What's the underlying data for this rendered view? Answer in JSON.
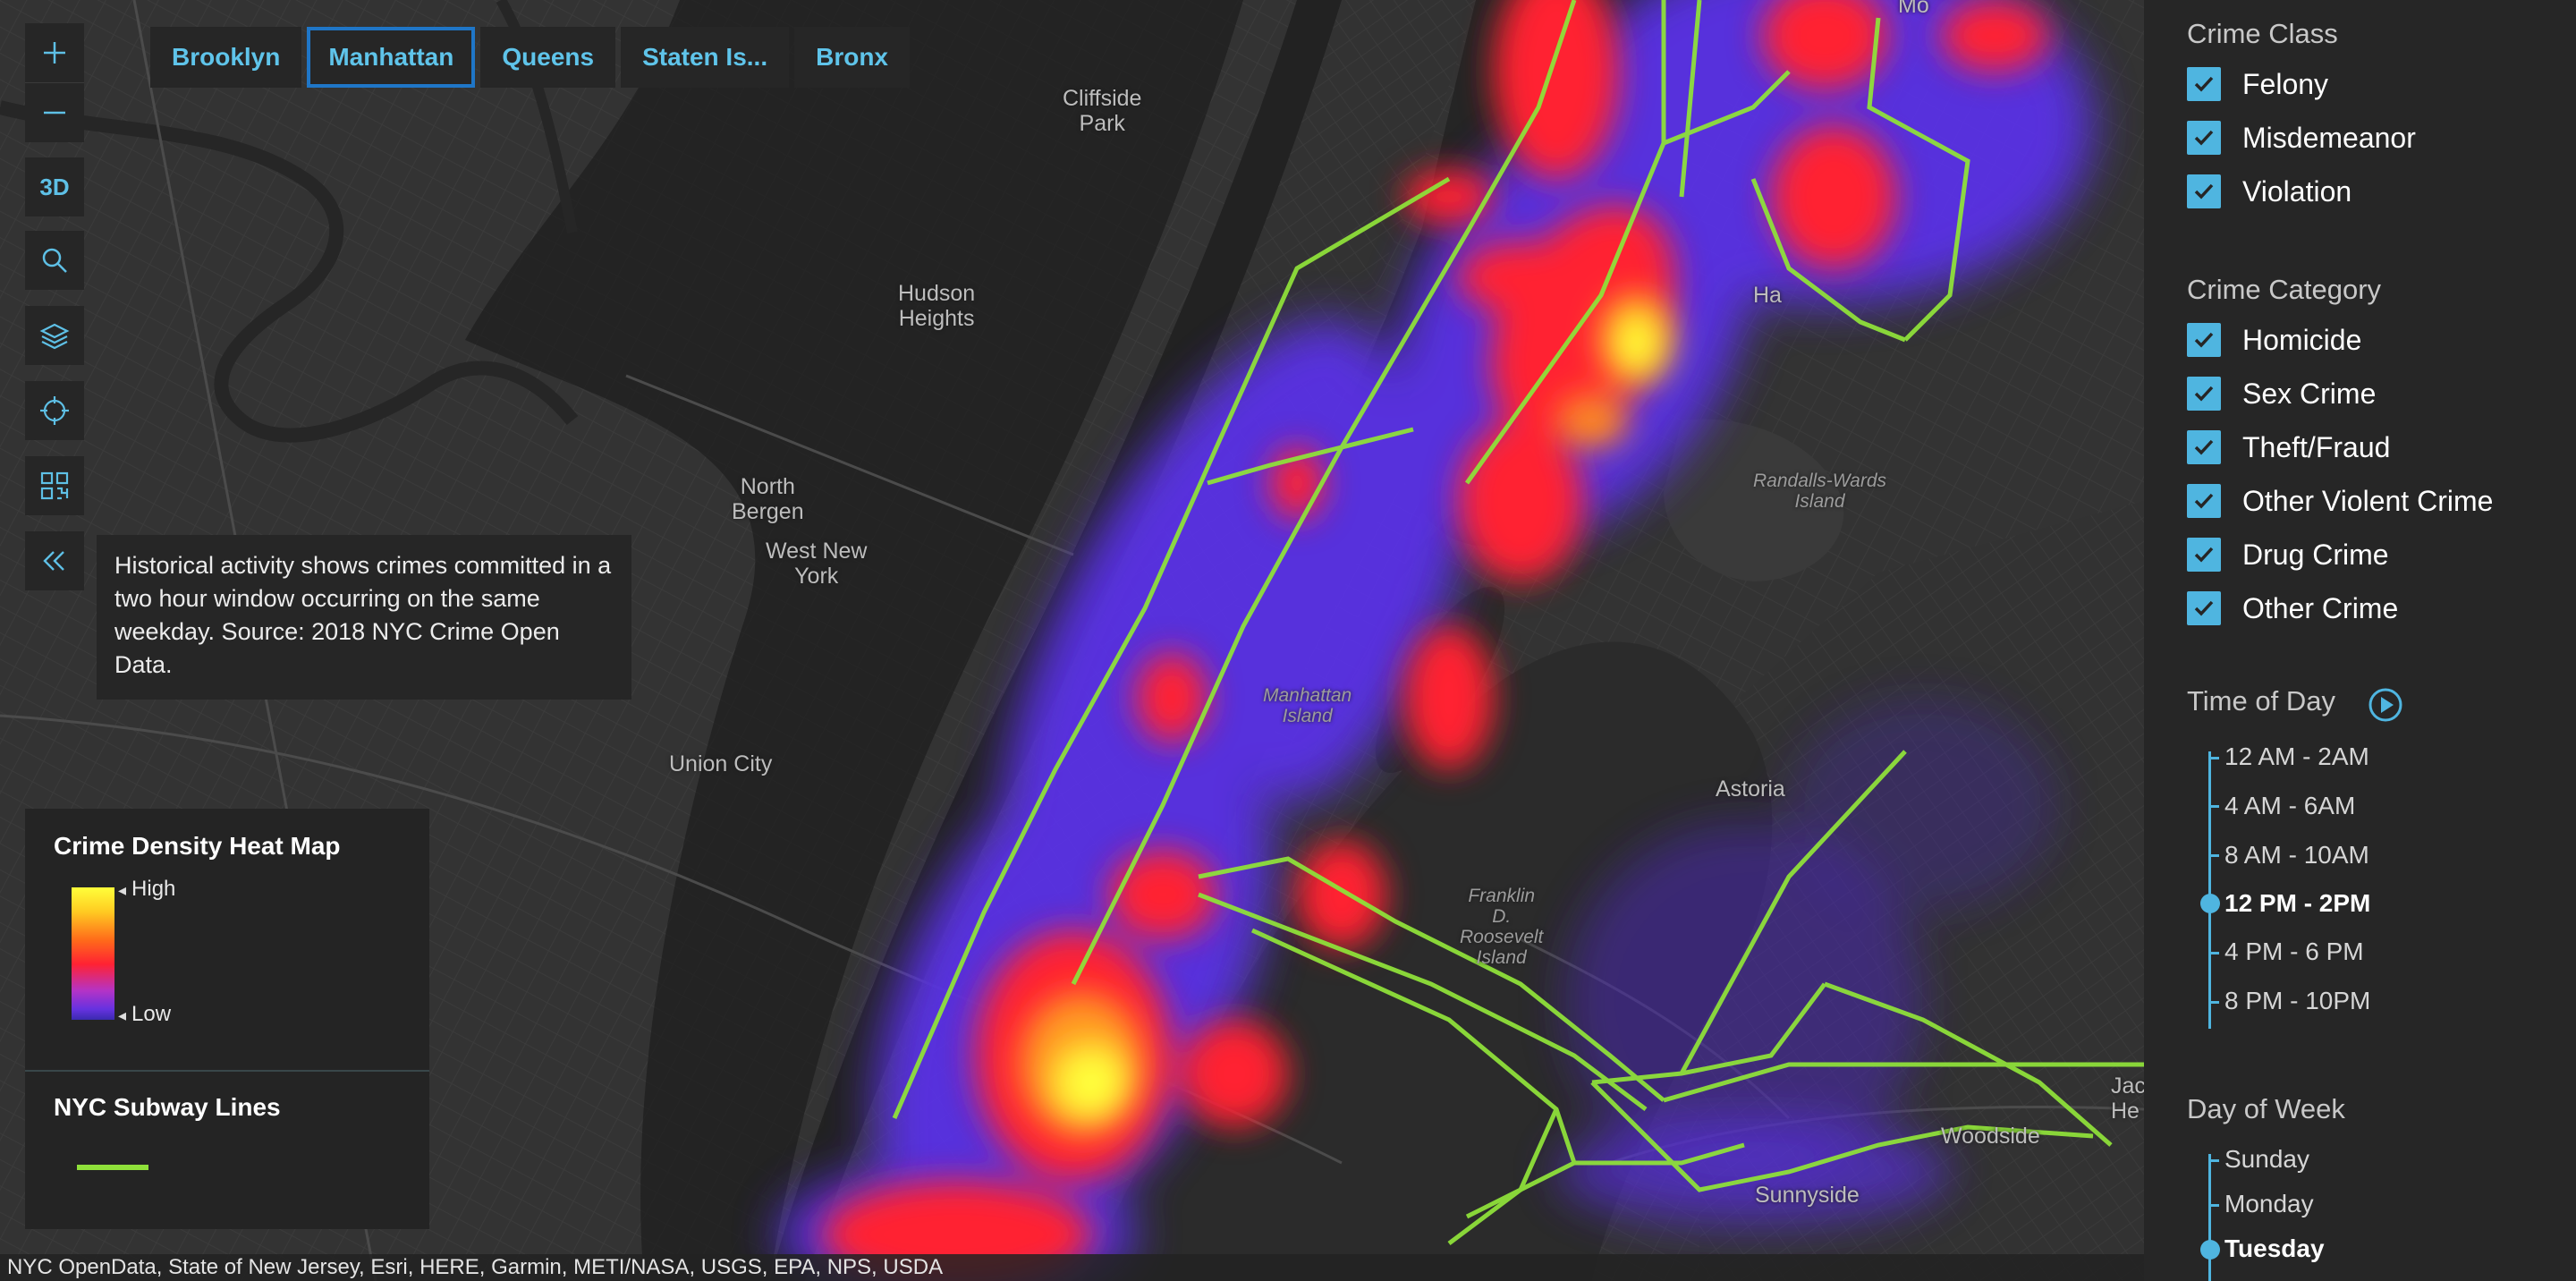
{
  "map": {
    "labels": {
      "cliffside_park": "Cliffside\nPark",
      "hudson_heights": "Hudson\nHeights",
      "north_bergen": "North\nBergen",
      "west_new_york": "West New\nYork",
      "union_city": "Union City",
      "manhattan_island": "Manhattan\nIsland",
      "randalls_wards": "Randalls-Wards\nIsland",
      "astoria": "Astoria",
      "franklin_roosevelt": "Franklin\nD.\nRoosevelt\nIsland",
      "woodside": "Woodside",
      "sunnyside": "Sunnyside",
      "jackson_heights": "Jac\nHe",
      "harlem": "Ha",
      "mott": "Mo"
    },
    "colors": {
      "land": "#333333",
      "water": "#232323",
      "parks": "#2c2c2c",
      "subway": "#8fe03a",
      "heat_high": "#ffff3a",
      "heat_low": "#5a30e6"
    }
  },
  "toolbar": {
    "zoom_in_icon": "plus-icon",
    "zoom_out_icon": "minus-icon",
    "mode_label": "3D",
    "search_icon": "search-icon",
    "layers_icon": "layers-icon",
    "locate_icon": "crosshair-icon",
    "qr_icon": "qr-icon",
    "collapse_icon": "double-chevron-left-icon"
  },
  "borough_tabs": [
    {
      "label": "Brooklyn",
      "active": false
    },
    {
      "label": "Manhattan",
      "active": true
    },
    {
      "label": "Queens",
      "active": false
    },
    {
      "label": "Staten Is...",
      "active": false
    },
    {
      "label": "Bronx",
      "active": false
    }
  ],
  "tooltip": {
    "text": "Historical activity shows crimes committed in a two hour window occurring on the same weekday. Source: 2018 NYC Crime Open Data."
  },
  "legend": {
    "heatmap_title": "Crime Density Heat Map",
    "high_label": "High",
    "low_label": "Low",
    "subway_title": "NYC Subway Lines"
  },
  "attribution": "NYC OpenData, State of New Jersey, Esri, HERE, Garmin, METI/NASA, USGS, EPA, NPS, USDA",
  "panel": {
    "crime_class": {
      "title": "Crime Class",
      "items": [
        {
          "label": "Felony",
          "checked": true
        },
        {
          "label": "Misdemeanor",
          "checked": true
        },
        {
          "label": "Violation",
          "checked": true
        }
      ]
    },
    "crime_category": {
      "title": "Crime Category",
      "items": [
        {
          "label": "Homicide",
          "checked": true
        },
        {
          "label": "Sex Crime",
          "checked": true
        },
        {
          "label": "Theft/Fraud",
          "checked": true
        },
        {
          "label": "Other Violent Crime",
          "checked": true
        },
        {
          "label": "Drug Crime",
          "checked": true
        },
        {
          "label": "Other Crime",
          "checked": true
        }
      ]
    },
    "time_of_day": {
      "title": "Time of Day",
      "play_icon": "play-circle-icon",
      "options": [
        "12 AM - 2AM",
        "4 AM - 6AM",
        "8 AM - 10AM",
        "12 PM - 2PM",
        "4 PM - 6 PM",
        "8 PM - 10PM"
      ],
      "selected": "12 PM - 2PM"
    },
    "day_of_week": {
      "title": "Day of Week",
      "options": [
        "Sunday",
        "Monday",
        "Tuesday"
      ],
      "selected": "Tuesday"
    },
    "accent_color": "#4fb5e0"
  }
}
